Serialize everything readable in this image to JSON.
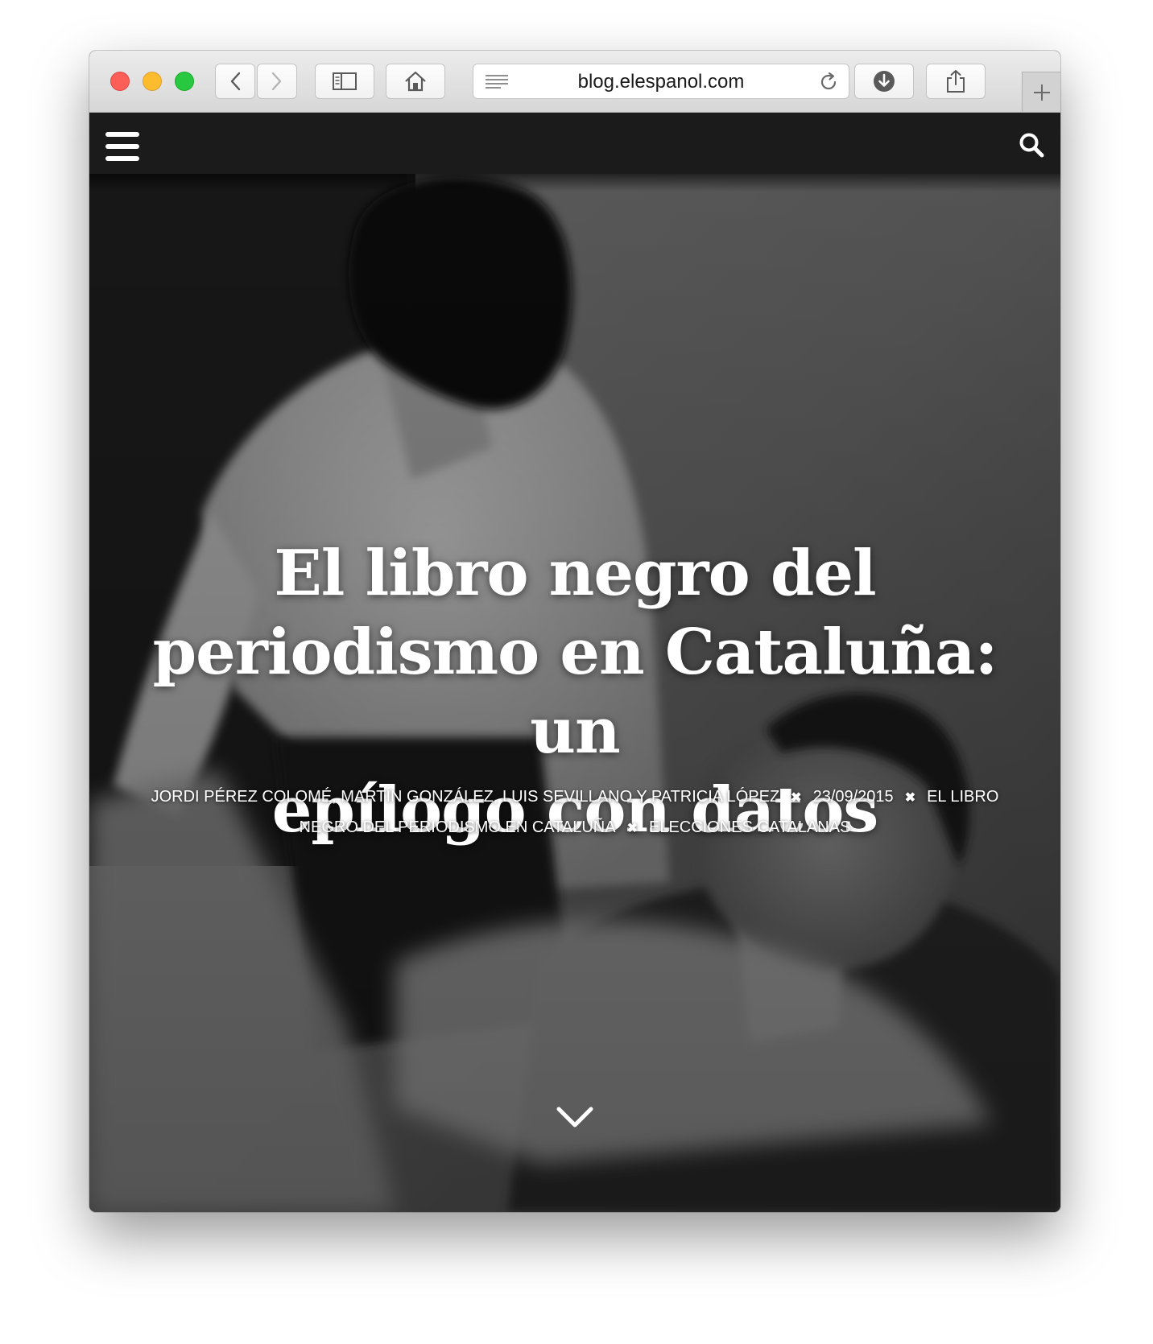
{
  "browser": {
    "url": "blog.elespanol.com",
    "icons": [
      "back-icon",
      "forward-icon",
      "sidebar-icon",
      "home-icon",
      "reader-icon",
      "reload-icon",
      "downloads-icon",
      "share-icon",
      "new-tab-icon"
    ]
  },
  "site_nav": {
    "icons": [
      "menu-icon",
      "search-icon"
    ]
  },
  "article": {
    "title_line1": "El libro negro del",
    "title_line2": "periodismo en Cataluña: un",
    "title_line3": "epílogo con datos",
    "authors": "JORDI PÉREZ COLOMÉ, MARTÍN GONZÁLEZ, LUIS SEVILLANO Y PATRICIA LÓPEZ",
    "date": "23/09/2015",
    "category_1": "EL LIBRO NEGRO DEL PERIODISMO EN CATALUÑA",
    "category_2": "ELECCIONES CATALANAS",
    "separator": "✖",
    "scroll_icon": "chevron-down-icon"
  },
  "colors": {
    "nav_bg": "#1b1b1b",
    "text": "#ffffff",
    "toolbar_bg": "#e2e2e2"
  }
}
